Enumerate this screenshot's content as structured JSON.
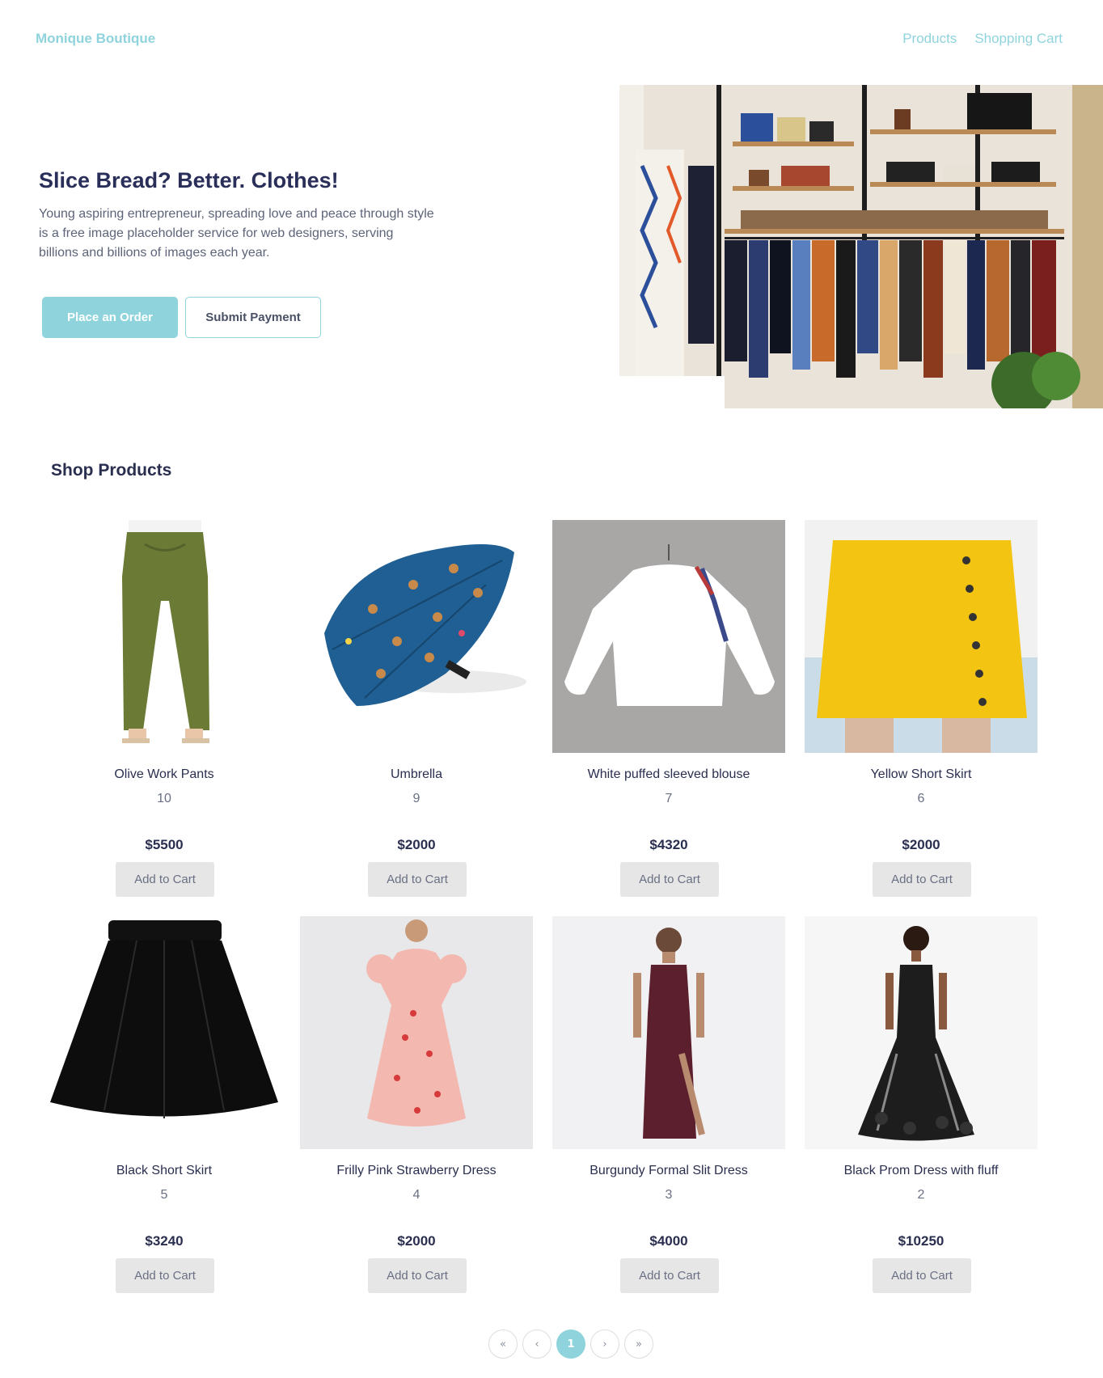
{
  "brand": "Monique Boutique",
  "nav": {
    "products": "Products",
    "cart": "Shopping Cart"
  },
  "hero": {
    "title": "Slice Bread? Better. Clothes!",
    "description": "Young aspiring entrepreneur, spreading love and peace through style is a free image placeholder service for web designers, serving billions and billions of images each year.",
    "primary_button": "Place an Order",
    "secondary_button": "Submit Payment"
  },
  "section_title": "Shop Products",
  "products": [
    {
      "name": "Olive Work Pants",
      "qty": "10",
      "price": "$5500",
      "button": "Add to Cart"
    },
    {
      "name": "Umbrella",
      "qty": "9",
      "price": "$2000",
      "button": "Add to Cart"
    },
    {
      "name": "White puffed sleeved blouse",
      "qty": "7",
      "price": "$4320",
      "button": "Add to Cart"
    },
    {
      "name": "Yellow Short Skirt",
      "qty": "6",
      "price": "$2000",
      "button": "Add to Cart"
    },
    {
      "name": "Black Short Skirt",
      "qty": "5",
      "price": "$3240",
      "button": "Add to Cart"
    },
    {
      "name": "Frilly Pink Strawberry Dress",
      "qty": "4",
      "price": "$2000",
      "button": "Add to Cart"
    },
    {
      "name": "Burgundy Formal Slit Dress",
      "qty": "3",
      "price": "$4000",
      "button": "Add to Cart"
    },
    {
      "name": "Black Prom Dress with fluff",
      "qty": "2",
      "price": "$10250",
      "button": "Add to Cart"
    }
  ],
  "pagination": {
    "first": "«",
    "prev": "‹",
    "current": "1",
    "next": "›",
    "last": "»"
  },
  "colors": {
    "accent": "#8fd4dd",
    "heading": "#2a2f5a",
    "button_gray": "#e6e6e6"
  }
}
